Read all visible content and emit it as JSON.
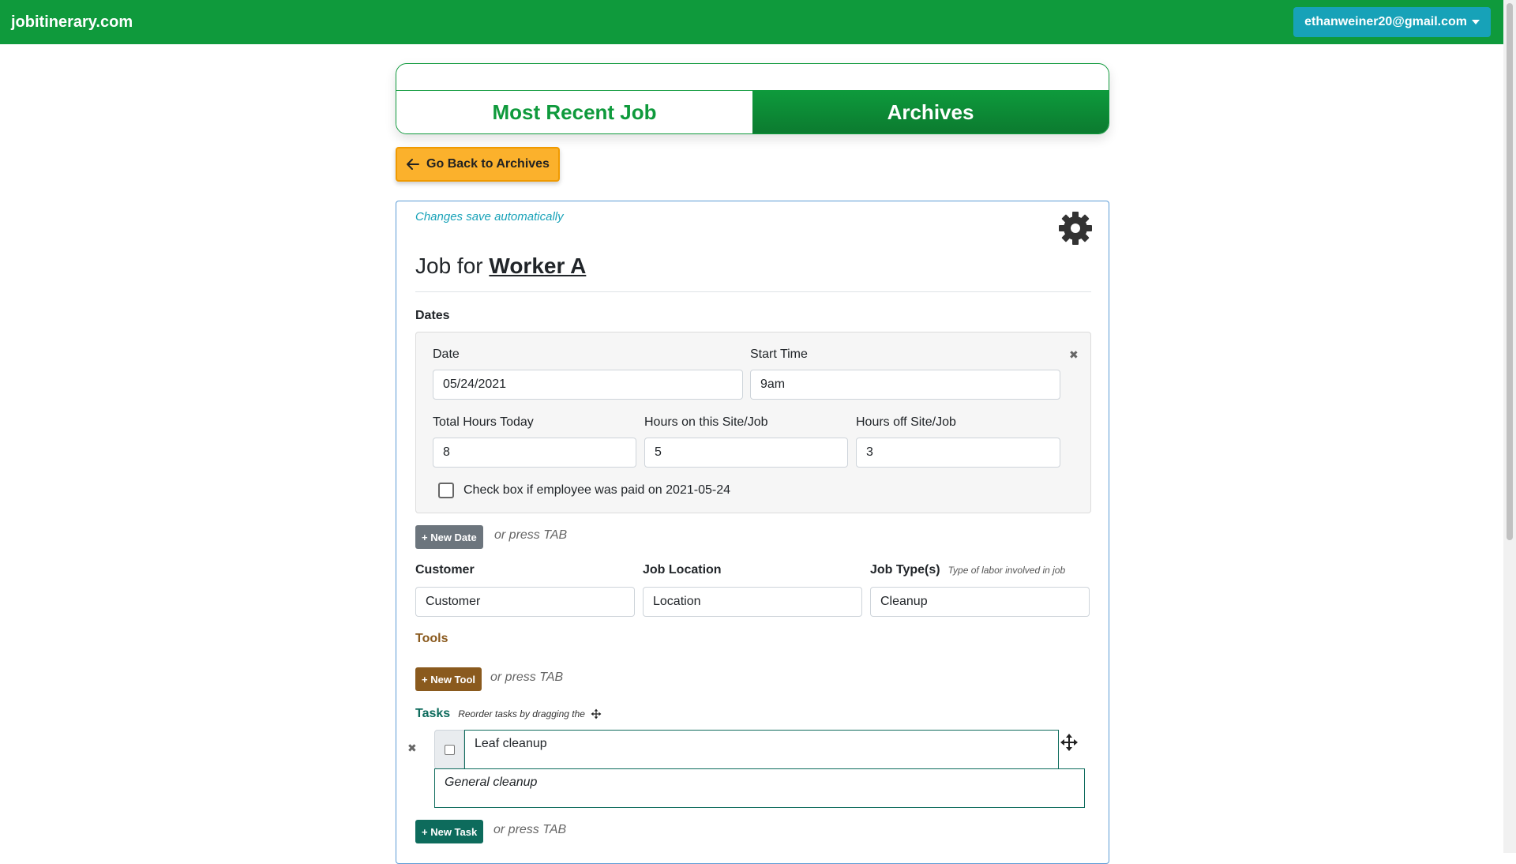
{
  "navbar": {
    "brand": "jobitinerary.com",
    "account_email": "ethanweiner20@gmail.com"
  },
  "tabs": {
    "most_recent": "Most Recent Job",
    "archives": "Archives"
  },
  "back_button": {
    "label": "Go Back to Archives"
  },
  "job": {
    "autosave_note": "Changes save automatically",
    "title_prefix": "Job for",
    "worker_name": "Worker A",
    "dates_heading": "Dates",
    "date_label": "Date",
    "date_value": "05/24/2021",
    "start_time_label": "Start Time",
    "start_time_value": "9am",
    "total_hours_label": "Total Hours Today",
    "total_hours_value": "8",
    "hours_on_label": "Hours on this Site/Job",
    "hours_on_value": "5",
    "hours_off_label": "Hours off Site/Job",
    "hours_off_value": "3",
    "paid_checkbox_label": "Check box if employee was paid on 2021-05-24",
    "new_date_button": "+ New Date",
    "or_press_tab": "or press TAB",
    "customer_label": "Customer",
    "customer_value": "Customer",
    "location_label": "Job Location",
    "location_value": "Location",
    "job_type_label": "Job Type(s)",
    "job_type_hint": "Type of labor involved in job",
    "job_type_value": "Cleanup",
    "tools_heading": "Tools",
    "new_tool_button": "+ New Tool",
    "tasks_heading": "Tasks",
    "tasks_hint": "Reorder tasks by dragging the",
    "task_title": "Leaf cleanup",
    "task_notes": "General cleanup",
    "new_task_button": "+ New Task"
  },
  "colors": {
    "brand_green": "#0f9a3c",
    "account_teal": "#17a2b8",
    "back_button_orange": "#fbb12c",
    "tools_brown": "#8a5a1e",
    "tasks_teal": "#0d6b5c",
    "new_date_gray": "#6c757d"
  },
  "icons": {
    "gear": "gear-icon",
    "back": "arrow-left-icon",
    "drag": "move-arrows-icon",
    "remove": "close-icon"
  }
}
